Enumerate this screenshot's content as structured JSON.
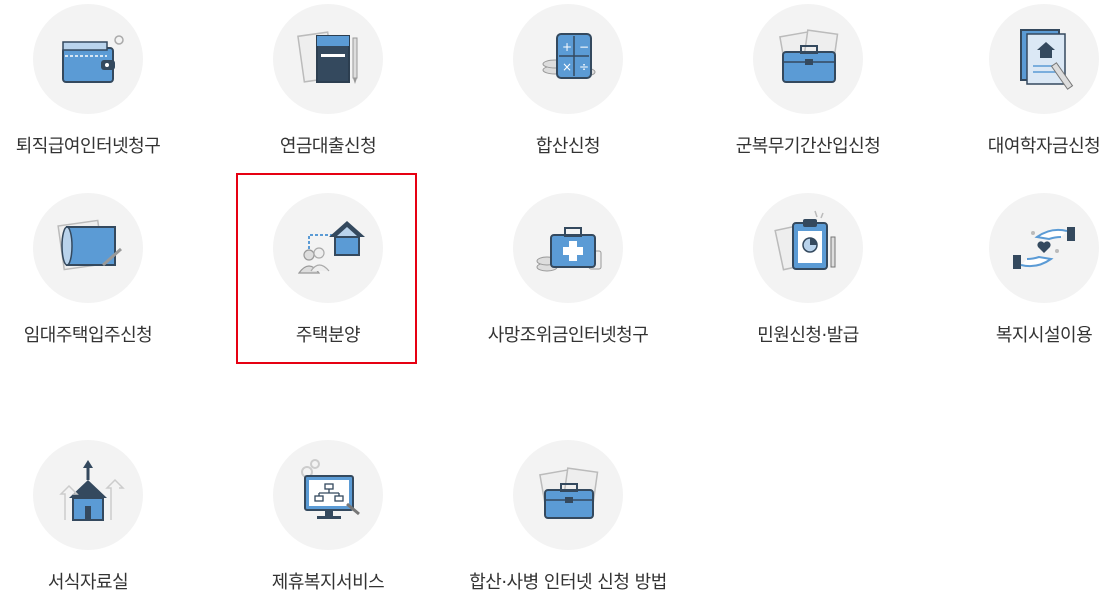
{
  "colors": {
    "icon_blue": "#5b9bd5",
    "icon_dark": "#34495e",
    "circle_bg": "#f3f3f3",
    "highlight": "#e60012"
  },
  "menu": {
    "items": [
      {
        "label": "퇴직급여인터넷청구",
        "icon": "wallet-icon"
      },
      {
        "label": "연금대출신청",
        "icon": "notebook-icon"
      },
      {
        "label": "합산신청",
        "icon": "calculator-icon"
      },
      {
        "label": "군복무기간산입신청",
        "icon": "briefcase-icon"
      },
      {
        "label": "대여학자금신청",
        "icon": "document-pencil-icon"
      },
      {
        "label": "임대주택입주신청",
        "icon": "blueprint-icon"
      },
      {
        "label": "주택분양",
        "icon": "house-person-icon"
      },
      {
        "label": "사망조위금인터넷청구",
        "icon": "first-aid-kit-icon"
      },
      {
        "label": "민원신청·발급",
        "icon": "clipboard-icon"
      },
      {
        "label": "복지시설이용",
        "icon": "helping-hands-heart-icon"
      },
      {
        "label": "서식자료실",
        "icon": "house-arrows-icon"
      },
      {
        "label": "제휴복지서비스",
        "icon": "monitor-network-icon"
      },
      {
        "label": "합산·사병 인터넷 신청 방법",
        "icon": "briefcase-papers-icon"
      }
    ],
    "selected": "주택분양"
  }
}
